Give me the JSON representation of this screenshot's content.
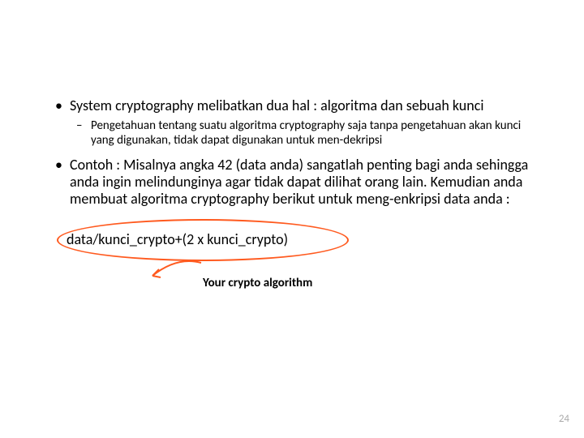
{
  "bullets": [
    {
      "level": 1,
      "text": "System cryptography melibatkan dua hal : algoritma dan sebuah kunci"
    },
    {
      "level": 2,
      "text": "Pengetahuan tentang suatu algoritma cryptography saja tanpa pengetahuan akan kunci yang digunakan, tidak dapat digunakan untuk men-dekripsi"
    },
    {
      "level": 1,
      "text": "Contoh : Misalnya angka 42 (data anda) sangatlah penting bagi anda sehingga anda ingin melindunginya agar tidak dapat dilihat orang lain. Kemudian anda membuat algoritma cryptography berikut untuk meng-enkripsi data anda :"
    }
  ],
  "formula": "data/kunci_crypto+(2 x kunci_crypto)",
  "caption": "Your crypto algorithm",
  "page_number": "24",
  "accent_color": "#ff5a1f"
}
